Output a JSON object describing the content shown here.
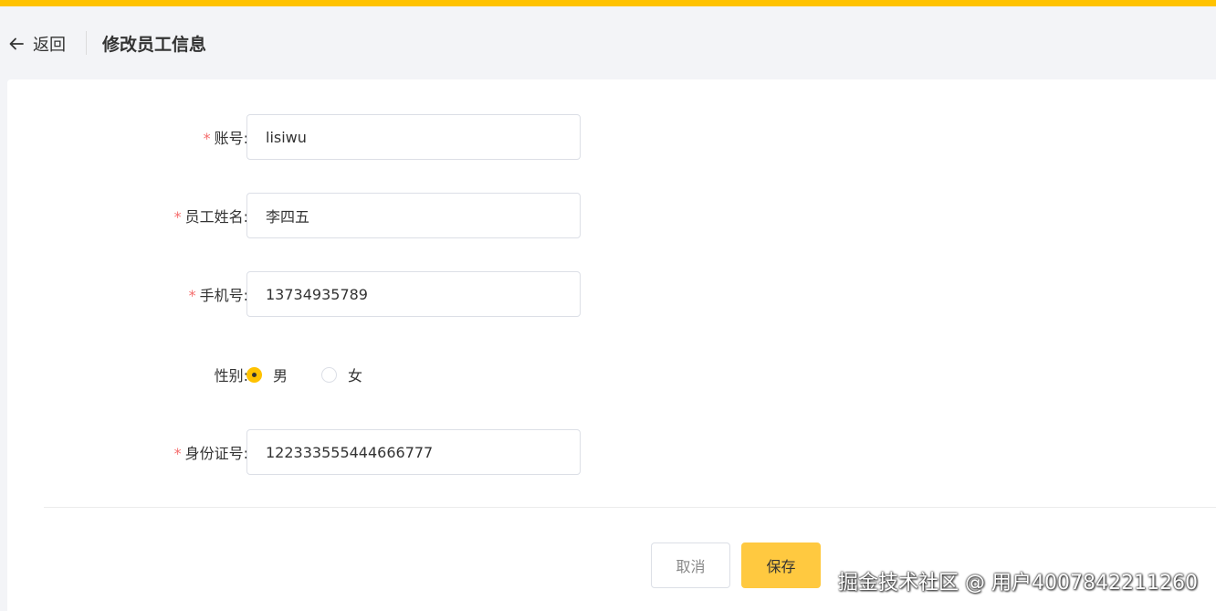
{
  "colors": {
    "accent": "#ffc200",
    "save_button": "#ffc940",
    "required_mark": "#f56c6c"
  },
  "header": {
    "back_label": "返回",
    "title": "修改员工信息"
  },
  "form": {
    "required_mark": "*",
    "account": {
      "label": "账号:",
      "value": "lisiwu"
    },
    "name": {
      "label": "员工姓名:",
      "value": "李四五"
    },
    "phone": {
      "label": "手机号:",
      "value": "13734935789"
    },
    "gender": {
      "label": "性别:",
      "options": [
        {
          "label": "男",
          "checked": true
        },
        {
          "label": "女",
          "checked": false
        }
      ]
    },
    "id_card": {
      "label": "身份证号:",
      "value": "122333555444666777"
    }
  },
  "actions": {
    "cancel_label": "取消",
    "save_label": "保存"
  },
  "watermark": "掘金技术社区 @ 用户4007842211260"
}
